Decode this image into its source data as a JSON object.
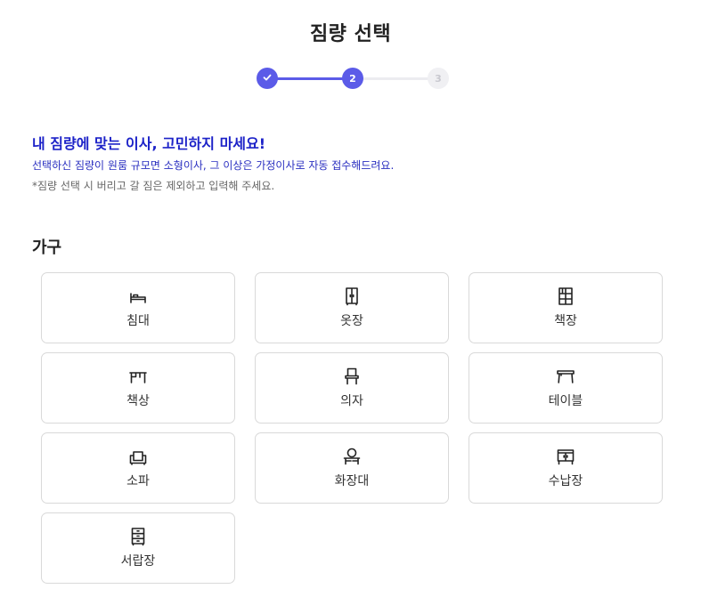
{
  "page": {
    "title": "짐량 선택"
  },
  "stepper": {
    "steps": [
      {
        "label": "",
        "state": "done",
        "icon": "check-icon"
      },
      {
        "label": "2",
        "state": "active"
      },
      {
        "label": "3",
        "state": "inactive"
      }
    ],
    "colors": {
      "active": "#5b5be8",
      "inactive": "#f0f0f3"
    }
  },
  "info": {
    "headline": "내 짐량에 맞는 이사, 고민하지 마세요!",
    "subtitle": "선택하신 짐량이 원룸 규모면 소형이사, 그 이상은 가정이사로 자동 접수해드려요.",
    "note": "*짐량 선택 시 버리고 갈 짐은 제외하고 입력해 주세요."
  },
  "section": {
    "title": "가구"
  },
  "furniture": [
    {
      "label": "침대",
      "icon": "bed-icon"
    },
    {
      "label": "옷장",
      "icon": "wardrobe-icon"
    },
    {
      "label": "책장",
      "icon": "bookshelf-icon"
    },
    {
      "label": "책상",
      "icon": "desk-icon"
    },
    {
      "label": "의자",
      "icon": "chair-icon"
    },
    {
      "label": "테이블",
      "icon": "table-icon"
    },
    {
      "label": "소파",
      "icon": "sofa-icon"
    },
    {
      "label": "화장대",
      "icon": "vanity-icon"
    },
    {
      "label": "수납장",
      "icon": "storage-cabinet-icon"
    },
    {
      "label": "서랍장",
      "icon": "drawer-chest-icon"
    }
  ]
}
